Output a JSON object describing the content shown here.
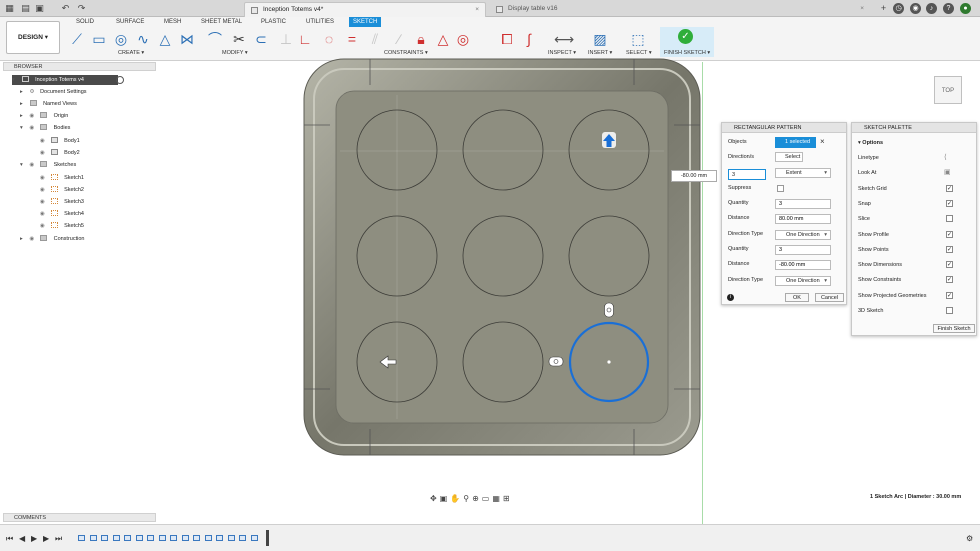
{
  "titlebar": {
    "active_tab": "Inception Totems v4*",
    "inactive_tab": "Display table v16",
    "close": "×"
  },
  "toolbar": {
    "design_label": "DESIGN ▾",
    "workspace_tabs": [
      "SOLID",
      "SURFACE",
      "MESH",
      "SHEET METAL",
      "PLASTIC",
      "UTILITIES",
      "SKETCH"
    ],
    "active_workspace": "SKETCH",
    "groups": {
      "create": "CREATE ▾",
      "modify": "MODIFY ▾",
      "constraints": "CONSTRAINTS ▾",
      "inspect": "INSPECT ▾",
      "insert": "INSERT ▾",
      "select": "SELECT ▾",
      "finish": "FINISH SKETCH ▾"
    }
  },
  "browser": {
    "header": "BROWSER",
    "items": [
      {
        "label": "Inception Totems v4"
      },
      {
        "label": "Document Settings"
      },
      {
        "label": "Named Views"
      },
      {
        "label": "Origin"
      },
      {
        "label": "Bodies"
      },
      {
        "label": "Body1"
      },
      {
        "label": "Body2"
      },
      {
        "label": "Sketches"
      },
      {
        "label": "Sketch1"
      },
      {
        "label": "Sketch2"
      },
      {
        "label": "Sketch3"
      },
      {
        "label": "Sketch4"
      },
      {
        "label": "Sketch5"
      },
      {
        "label": "Construction"
      }
    ],
    "comments": "COMMENTS"
  },
  "viewcube": {
    "label": "TOP"
  },
  "dimension_input": "-80.00 mm",
  "pattern_dialog": {
    "title": "RECTANGULAR PATTERN",
    "objects_label": "Objects",
    "objects_value": "1 selected",
    "directions_label": "Direction/s",
    "directions_value": "Select",
    "count_value": "3",
    "distribution_value": "Extent",
    "suppress_label": "Suppress",
    "quantity1_label": "Quantity",
    "quantity1_value": "3",
    "distance1_label": "Distance",
    "distance1_value": "80.00 mm",
    "direction_type1_label": "Direction Type",
    "direction_type1_value": "One Direction",
    "quantity2_label": "Quantity",
    "quantity2_value": "3",
    "distance2_label": "Distance",
    "distance2_value": "-80.00 mm",
    "direction_type2_label": "Direction Type",
    "direction_type2_value": "One Direction",
    "ok": "OK",
    "cancel": "Cancel",
    "info": "i"
  },
  "sketch_palette": {
    "title": "SKETCH PALETTE",
    "section": "Options",
    "rows": [
      {
        "label": "Linetype",
        "checked": null
      },
      {
        "label": "Look At",
        "checked": null
      },
      {
        "label": "Sketch Grid",
        "checked": true
      },
      {
        "label": "Snap",
        "checked": true
      },
      {
        "label": "Slice",
        "checked": false
      },
      {
        "label": "Show Profile",
        "checked": true
      },
      {
        "label": "Show Points",
        "checked": true
      },
      {
        "label": "Show Dimensions",
        "checked": true
      },
      {
        "label": "Show Constraints",
        "checked": true
      },
      {
        "label": "Show Projected Geometries",
        "checked": true
      },
      {
        "label": "3D Sketch",
        "checked": false
      }
    ],
    "finish_button": "Finish Sketch"
  },
  "status_text": "1 Sketch Arc | Diameter : 30.00 mm",
  "colors": {
    "accent": "#1a8ed8",
    "selected_circle": "#1a6fd6",
    "plate_face": "#8e8e80"
  }
}
